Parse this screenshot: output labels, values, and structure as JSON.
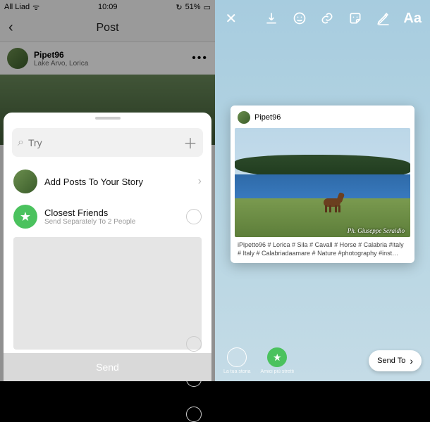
{
  "status": {
    "carrier": "All Liad",
    "wifi": "ᯤ",
    "time": "10:09",
    "sync": "↻",
    "battery_pct": "51%",
    "battery_icon": "▭"
  },
  "nav": {
    "back": "‹",
    "title": "Post"
  },
  "post": {
    "username": "Pipet96",
    "location": "Lake Arvo, Lorica",
    "more": "•••"
  },
  "sheet": {
    "search_placeholder": "Try",
    "search_icon_char": "⌕",
    "plus": "＋",
    "story_row": "Add Posts To Your Story",
    "chevron": "›",
    "cf_label": "Closest Friends",
    "cf_sub": "Send Separately To 2 People",
    "cf_star": "★",
    "send": "Send"
  },
  "editor": {
    "close": "✕",
    "aa": "Aa",
    "card_user": "Pipet96",
    "watermark": "Ph. Giuseppe Seraidio",
    "caption": "iPipetto96 # Lorica # Sila # Cavall # Horse # Calabria #italy # Italy # Calabriadaamare # Nature #photography #inst…",
    "your_story": "La tua storia",
    "close_friends": "Amici più stretti",
    "send_to": "Send To",
    "send_chev": "›"
  }
}
